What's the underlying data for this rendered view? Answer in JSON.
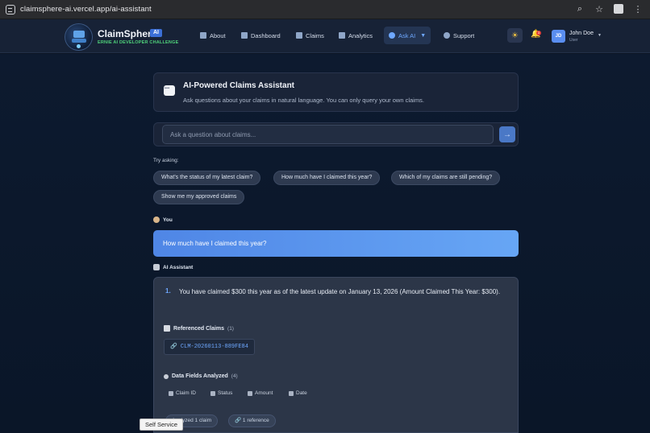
{
  "browser": {
    "url": "claimsphere-ai.vercel.app/ai-assistant"
  },
  "header": {
    "brand": "ClaimSphere",
    "brand_badge": "AI",
    "tagline": "ERNIE AI DEVELOPER CHALLENGE",
    "nav": [
      {
        "label": "About",
        "icon": "info-icon"
      },
      {
        "label": "Dashboard",
        "icon": "dashboard-icon"
      },
      {
        "label": "Claims",
        "icon": "document-icon"
      },
      {
        "label": "Analytics",
        "icon": "chart-icon"
      },
      {
        "label": "Ask AI",
        "icon": "chat-icon",
        "active": true
      },
      {
        "label": "Support",
        "icon": "headset-icon"
      }
    ],
    "notification_count": "3",
    "user": {
      "initials": "JD",
      "name": "John Doe",
      "role": "User"
    }
  },
  "intro": {
    "title": "AI-Powered Claims Assistant",
    "description": "Ask questions about your claims in natural language. You can only query your own claims."
  },
  "ask": {
    "placeholder": "Ask a question about claims...",
    "send": "→"
  },
  "suggestions": {
    "label": "Try asking:",
    "items": [
      "What's the status of my latest claim?",
      "How much have I claimed this year?",
      "Which of my claims are still pending?",
      "Show me my approved claims"
    ]
  },
  "conversation": {
    "user_label": "You",
    "user_message": "How much have I claimed this year?",
    "ai_label": "AI Assistant",
    "answer_number": "1.",
    "answer_text": "You have claimed $300 this year as of the latest update on January 13, 2026 (Amount Claimed This Year: $300).",
    "referenced_title": "Referenced Claims",
    "referenced_count": "(1)",
    "claim_id": "CLM-20260113-889FE84",
    "fields_title": "Data Fields Analyzed",
    "fields_count": "(4)",
    "fields": [
      "Claim ID",
      "Status",
      "Amount",
      "Date"
    ],
    "footer_pills": [
      "Analyzed 1 claim",
      "1 reference"
    ]
  },
  "tooltip": "Self Service",
  "colors": {
    "accent": "#6ea8ff",
    "primary_button": "#4a78c6",
    "user_bubble": "#5b96ee",
    "tag_green": "#4fd17a"
  }
}
